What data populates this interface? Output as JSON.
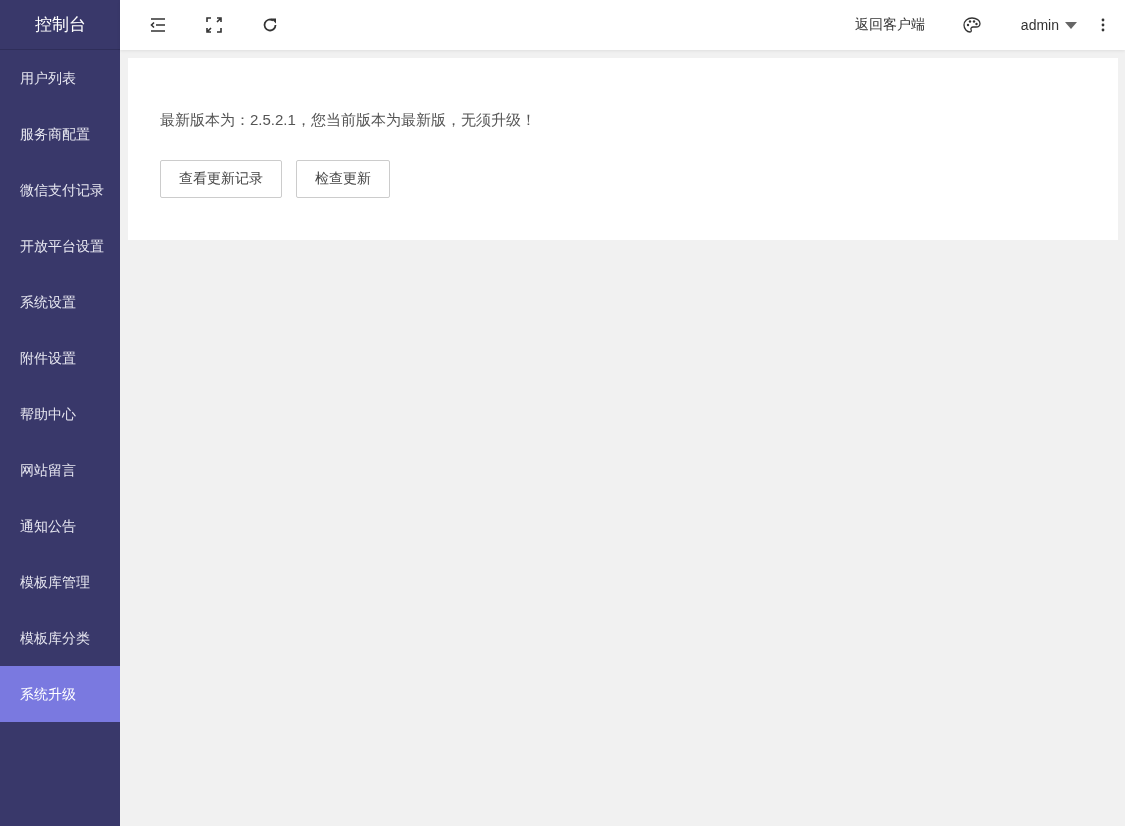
{
  "sidebar": {
    "title": "控制台",
    "items": [
      {
        "label": "用户列表",
        "selected": false
      },
      {
        "label": "服务商配置",
        "selected": false
      },
      {
        "label": "微信支付记录",
        "selected": false
      },
      {
        "label": "开放平台设置",
        "selected": false
      },
      {
        "label": "系统设置",
        "selected": false
      },
      {
        "label": "附件设置",
        "selected": false
      },
      {
        "label": "帮助中心",
        "selected": false
      },
      {
        "label": "网站留言",
        "selected": false
      },
      {
        "label": "通知公告",
        "selected": false
      },
      {
        "label": "模板库管理",
        "selected": false
      },
      {
        "label": "模板库分类",
        "selected": false
      },
      {
        "label": "系统升级",
        "selected": true
      }
    ]
  },
  "header": {
    "client_link": "返回客户端",
    "user": "admin"
  },
  "card": {
    "message": "最新版本为：2.5.2.1，您当前版本为最新版，无须升级！",
    "buttons": [
      "查看更新记录",
      "检查更新"
    ]
  }
}
